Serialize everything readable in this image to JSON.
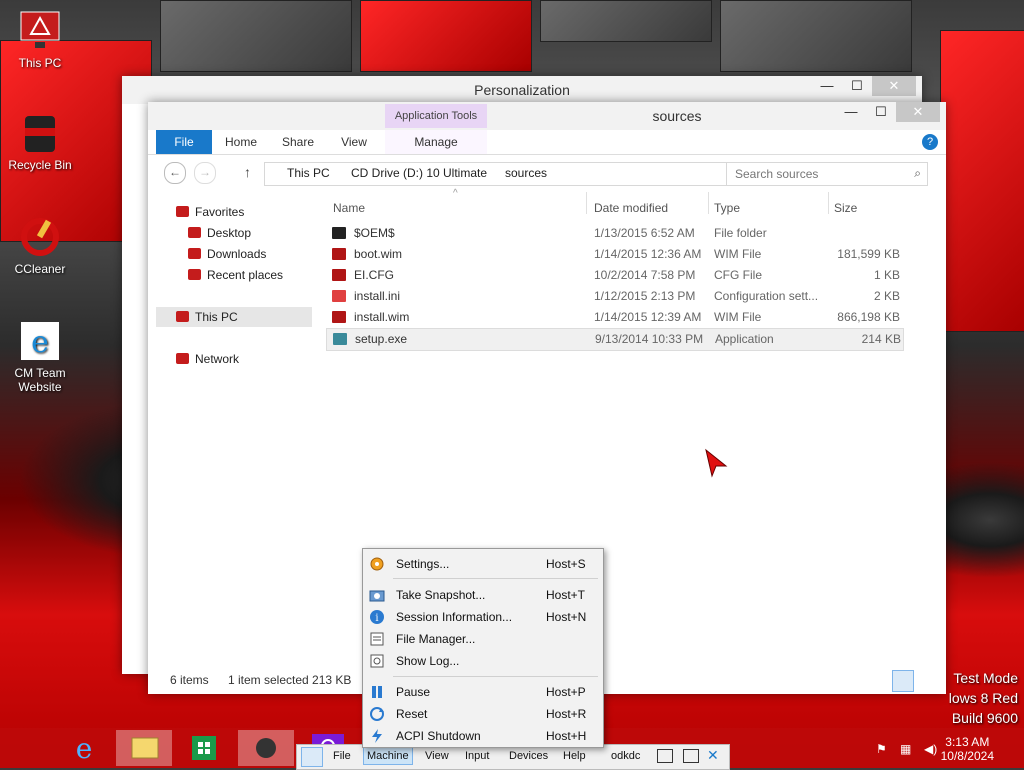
{
  "desktop": {
    "icons": [
      {
        "label": "This PC"
      },
      {
        "label": "Recycle Bin"
      },
      {
        "label": "CCleaner"
      },
      {
        "label": "CM Team Website"
      }
    ],
    "watermark": [
      "Test Mode",
      "lows 8 Red",
      "Build 9600"
    ]
  },
  "personalization": {
    "title": "Personalization"
  },
  "explorer": {
    "title": "sources",
    "app_tools": "Application Tools",
    "tabs": [
      "File",
      "Home",
      "Share",
      "View",
      "Manage"
    ],
    "breadcrumb": [
      "This PC",
      "CD Drive (D:) 10 Ultimate",
      "sources"
    ],
    "search_placeholder": "Search sources",
    "nav": {
      "favorites": "Favorites",
      "desktop": "Desktop",
      "downloads": "Downloads",
      "recent": "Recent places",
      "this_pc": "This PC",
      "network": "Network"
    },
    "columns": [
      "Name",
      "Date modified",
      "Type",
      "Size"
    ],
    "files": [
      {
        "name": "$OEM$",
        "date": "1/13/2015 6:52 AM",
        "type": "File folder",
        "size": ""
      },
      {
        "name": "boot.wim",
        "date": "1/14/2015 12:36 AM",
        "type": "WIM File",
        "size": "181,599 KB"
      },
      {
        "name": "EI.CFG",
        "date": "10/2/2014 7:58 PM",
        "type": "CFG File",
        "size": "1 KB"
      },
      {
        "name": "install.ini",
        "date": "1/12/2015 2:13 PM",
        "type": "Configuration sett...",
        "size": "2 KB"
      },
      {
        "name": "install.wim",
        "date": "1/14/2015 12:39 AM",
        "type": "WIM File",
        "size": "866,198 KB"
      },
      {
        "name": "setup.exe",
        "date": "9/13/2014 10:33 PM",
        "type": "Application",
        "size": "214 KB"
      }
    ],
    "status": {
      "count": "6 items",
      "selected": "1 item selected  213 KB"
    }
  },
  "machine_menu": {
    "items": [
      {
        "label": "Settings...",
        "key": "Host+S"
      },
      {
        "label": "Take Snapshot...",
        "key": "Host+T"
      },
      {
        "label": "Session Information...",
        "key": "Host+N"
      },
      {
        "label": "File Manager...",
        "key": ""
      },
      {
        "label": "Show Log...",
        "key": ""
      },
      {
        "label": "Pause",
        "key": "Host+P"
      },
      {
        "label": "Reset",
        "key": "Host+R"
      },
      {
        "label": "ACPI Shutdown",
        "key": "Host+H"
      }
    ]
  },
  "vbox_menubar": [
    "File",
    "Machine",
    "View",
    "Input",
    "Devices",
    "Help",
    "odkdc"
  ],
  "clock": {
    "time": "3:13 AM",
    "date": "10/8/2024"
  },
  "colors": {
    "accent": "#1979ca",
    "taskbar": "#be0a0a",
    "app_tools": "#e8d5f5"
  }
}
